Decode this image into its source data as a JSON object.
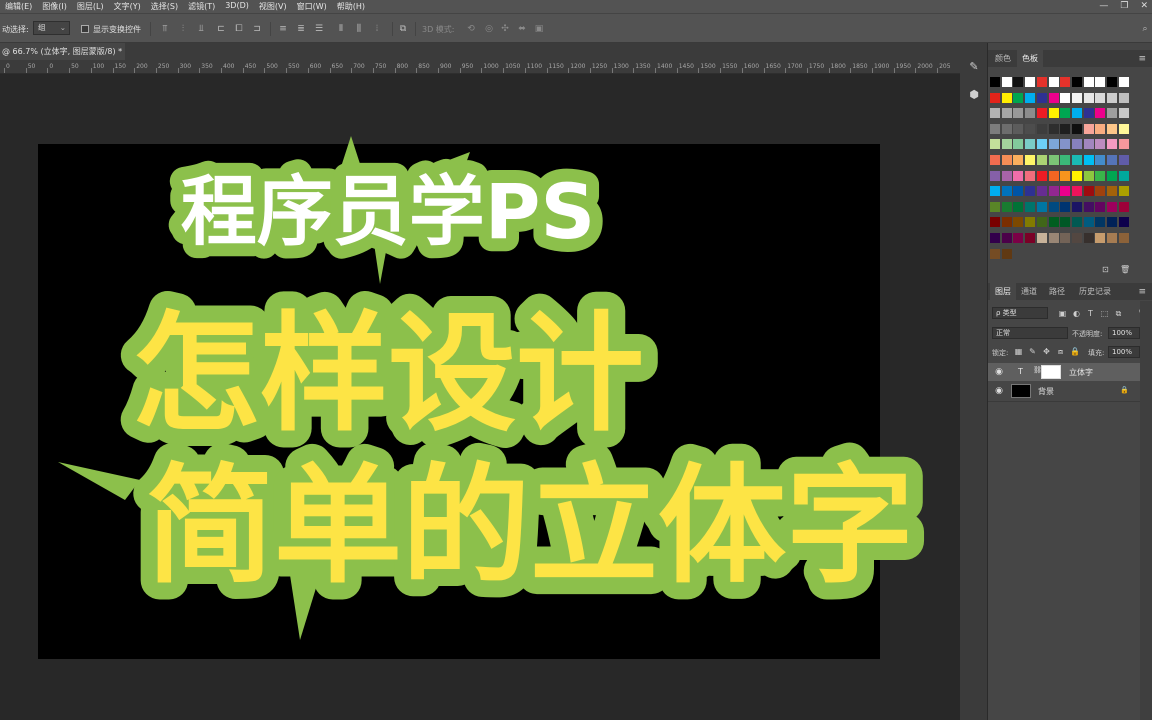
{
  "menubar": {
    "items": [
      "编辑(E)",
      "图像(I)",
      "图层(L)",
      "文字(Y)",
      "选择(S)",
      "滤镜(T)",
      "3D(D)",
      "视图(V)",
      "窗口(W)",
      "帮助(H)"
    ],
    "window_controls": [
      "—",
      "❐",
      "✕"
    ]
  },
  "options_bar": {
    "auto_select_label": "动选择:",
    "auto_select_value": "组",
    "show_transform_label": "显示变换控件",
    "mode_3d_label": "3D 模式:",
    "search_icon": "search-icon"
  },
  "document": {
    "tab_title": "@ 66.7% (立体字, 图层蒙版/8) *",
    "close_glyph": "×"
  },
  "ruler": {
    "ticks": [
      "0",
      "50",
      "0",
      "50",
      "100",
      "150",
      "200",
      "250",
      "300",
      "350",
      "400",
      "450",
      "500",
      "550",
      "600",
      "650",
      "700",
      "750",
      "800",
      "850",
      "900",
      "950",
      "1000",
      "1050",
      "1100",
      "1150",
      "1200",
      "1250",
      "1300",
      "1350",
      "1400",
      "1450",
      "1500",
      "1550",
      "1600",
      "1650",
      "1700",
      "1750",
      "1800",
      "1850",
      "1900",
      "1950",
      "2000",
      "205"
    ]
  },
  "canvas_art": {
    "line1": "程序员学PS",
    "line2": "怎样设计",
    "line3": "简单的立体字",
    "line1_color": "#ffffff",
    "line23_color": "#fde445",
    "outline_color": "#8cc04b",
    "background": "#000000"
  },
  "right_strip_icons": [
    "brush-settings-icon",
    "3d-cube-icon"
  ],
  "swatches_panel": {
    "tabs": [
      "颜色",
      "色板"
    ],
    "active_tab": "色板",
    "rows": [
      [
        "#000000",
        "#ffffff",
        "#111111",
        "#ffffff",
        "#e4322b",
        "#ffffff",
        "#e4322b",
        "#000000",
        "#ffffff",
        "#ffffff",
        "#000000",
        "#ffffff"
      ],
      [
        "#e2231a",
        "#ffed00",
        "#00a650",
        "#00aeef",
        "#2e3192",
        "#ec008c",
        "#ffffff",
        "#f2f2f2",
        "#e6e6e6",
        "#d9d9d9",
        "#cccccc",
        "#bfbfbf"
      ],
      [
        "#b3b3b3",
        "#a6a6a6",
        "#999999",
        "#8c8c8c",
        "#ed1c24",
        "#fff200",
        "#00a651",
        "#00aeef",
        "#2e3192",
        "#ec008c",
        "#9e9e9e",
        "#c8c8c8"
      ],
      [
        "#7d7d7d",
        "#6d6d6d",
        "#5c5c5c",
        "#4d4d4d",
        "#3d3d3d",
        "#2e2e2e",
        "#1f1f1f",
        "#0f0f0f",
        "#f7a59a",
        "#f9ad81",
        "#fdc689",
        "#fff799"
      ],
      [
        "#c4df9b",
        "#a3d39c",
        "#82ca9c",
        "#7accc8",
        "#6dcff6",
        "#7da7d8",
        "#8393ca",
        "#8781bd",
        "#a186be",
        "#bd8cbf",
        "#f49ac1",
        "#f5989d"
      ],
      [
        "#f26c4f",
        "#f68e56",
        "#fbaf5d",
        "#fff568",
        "#acd373",
        "#7cc576",
        "#3bb878",
        "#1abbb4",
        "#00bff3",
        "#438ccb",
        "#5574b9",
        "#605ca8"
      ],
      [
        "#8560a8",
        "#a864a8",
        "#f06eaa",
        "#f26d7d",
        "#ed1c24",
        "#f26522",
        "#f7941d",
        "#fff200",
        "#8dc73f",
        "#39b54a",
        "#00a651",
        "#00a99d"
      ],
      [
        "#00aeef",
        "#0072bc",
        "#0054a6",
        "#2e3192",
        "#662d91",
        "#92278f",
        "#ec008c",
        "#ed145b",
        "#9e0b0f",
        "#a0410d",
        "#a3620a",
        "#aba000"
      ],
      [
        "#598527",
        "#197b30",
        "#007236",
        "#00746b",
        "#0076a3",
        "#004a80",
        "#003471",
        "#1b1464",
        "#440e62",
        "#630460",
        "#9e005d",
        "#9e0039"
      ],
      [
        "#790000",
        "#7b2e00",
        "#7d4900",
        "#827b00",
        "#406618",
        "#005e20",
        "#005826",
        "#005952",
        "#005b7f",
        "#003663",
        "#002157",
        "#0d004c"
      ],
      [
        "#32004b",
        "#4b0049",
        "#7b0046",
        "#7a0026",
        "#c7b299",
        "#998675",
        "#736357",
        "#534741",
        "#37302d",
        "#c69c6d",
        "#a67c52",
        "#8c6239"
      ],
      [
        "#754c24",
        "#603913"
      ]
    ]
  },
  "layers_panel": {
    "tabs": [
      "图层",
      "通道",
      "路径",
      "历史记录"
    ],
    "active_tab": "图层",
    "kind_filter": "ρ 类型",
    "blend_mode": "正常",
    "opacity_label": "不透明度:",
    "opacity_value": "100%",
    "lock_label": "锁定:",
    "fill_label": "填充:",
    "fill_value": "100%",
    "layers": [
      {
        "name": "立体字",
        "type_glyph": "T",
        "thumb_color": "#ffffff",
        "selected": true,
        "visible": true,
        "locked": false
      },
      {
        "name": "背景",
        "type_glyph": "",
        "thumb_color": "#000000",
        "selected": false,
        "visible": true,
        "locked": true
      }
    ]
  }
}
